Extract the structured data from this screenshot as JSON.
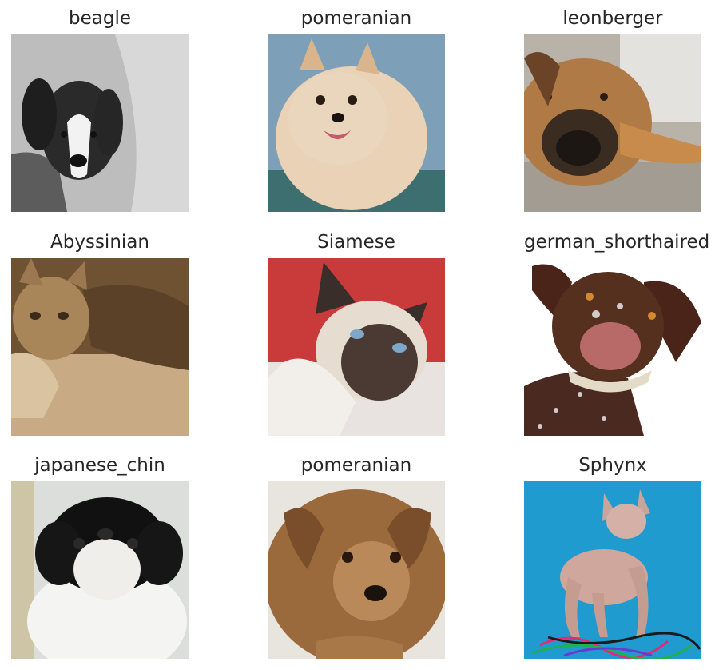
{
  "grid": {
    "cells": [
      {
        "label": "beagle",
        "subject": "black-and-white photo of a beagle lying on a blanket"
      },
      {
        "label": "pomeranian",
        "subject": "fluffy cream pomeranian against blue background"
      },
      {
        "label": "leonberger",
        "subject": "close-up of a leonberger dog resting head on ground"
      },
      {
        "label": "Abyssinian",
        "subject": "tan kitten lying on a beige fleece"
      },
      {
        "label": "Siamese",
        "subject": "siamese cat against a red couch"
      },
      {
        "label": "german_shorthaired",
        "subject": "brown ticked german shorthaired pointer with snow on face"
      },
      {
        "label": "japanese_chin",
        "subject": "black and white japanese chin looking up"
      },
      {
        "label": "pomeranian",
        "subject": "brown fluffy puppy on white background"
      },
      {
        "label": "Sphynx",
        "subject": "hairless sphynx cat on blue background with ribbons"
      }
    ]
  },
  "colors": {
    "label_text": "#262626",
    "background": "#ffffff"
  }
}
